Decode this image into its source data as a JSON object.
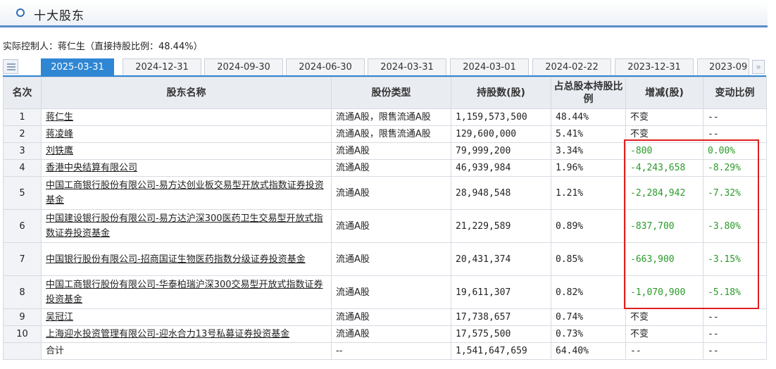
{
  "header": {
    "title": "十大股东"
  },
  "controller_text": "实际控制人：蒋仁生（直接持股比例：48.44%）",
  "tabs": [
    "2025-03-31",
    "2024-12-31",
    "2024-09-30",
    "2024-06-30",
    "2024-03-31",
    "2024-03-01",
    "2024-02-22",
    "2023-12-31",
    "2023-09"
  ],
  "active_tab": "2025-03-31",
  "table": {
    "headers": [
      "名次",
      "股东名称",
      "股份类型",
      "持股数(股)",
      "占总股本持股比例",
      "增减(股)",
      "变动比例"
    ],
    "rows": [
      {
        "rank": "1",
        "name": "蒋仁生",
        "type": "流通A股，限售流通A股",
        "shares": "1,159,573,500",
        "pct": "48.44%",
        "change": "不变",
        "ratio": "--"
      },
      {
        "rank": "2",
        "name": "蒋凌峰",
        "type": "流通A股，限售流通A股",
        "shares": "129,600,000",
        "pct": "5.41%",
        "change": "不变",
        "ratio": "--"
      },
      {
        "rank": "3",
        "name": "刘铁鹰",
        "type": "流通A股",
        "shares": "79,999,200",
        "pct": "3.34%",
        "change": "-800",
        "ratio": "0.00%"
      },
      {
        "rank": "4",
        "name": "香港中央结算有限公司",
        "type": "流通A股",
        "shares": "46,939,984",
        "pct": "1.96%",
        "change": "-4,243,658",
        "ratio": "-8.29%"
      },
      {
        "rank": "5",
        "name": "中国工商银行股份有限公司-易方达创业板交易型开放式指数证券投资基金",
        "type": "流通A股",
        "shares": "28,948,548",
        "pct": "1.21%",
        "change": "-2,284,942",
        "ratio": "-7.32%"
      },
      {
        "rank": "6",
        "name": "中国建设银行股份有限公司-易方达沪深300医药卫生交易型开放式指数证券投资基金",
        "type": "流通A股",
        "shares": "21,229,589",
        "pct": "0.89%",
        "change": "-837,700",
        "ratio": "-3.80%"
      },
      {
        "rank": "7",
        "name": "中国银行股份有限公司-招商国证生物医药指数分级证券投资基金",
        "type": "流通A股",
        "shares": "20,431,374",
        "pct": "0.85%",
        "change": "-663,900",
        "ratio": "-3.15%"
      },
      {
        "rank": "8",
        "name": "中国工商银行股份有限公司-华泰柏瑞沪深300交易型开放式指数证券投资基金",
        "type": "流通A股",
        "shares": "19,611,307",
        "pct": "0.82%",
        "change": "-1,070,900",
        "ratio": "-5.18%"
      },
      {
        "rank": "9",
        "name": "吴冠江",
        "type": "流通A股",
        "shares": "17,738,657",
        "pct": "0.74%",
        "change": "不变",
        "ratio": "--"
      },
      {
        "rank": "10",
        "name": "上海迎水投资管理有限公司-迎水合力13号私募证券投资基金",
        "type": "流通A股",
        "shares": "17,575,500",
        "pct": "0.73%",
        "change": "不变",
        "ratio": "--"
      }
    ],
    "total": {
      "label": "合计",
      "type": "--",
      "shares": "1,541,647,659",
      "pct": "64.40%",
      "change": "--",
      "ratio": "--"
    }
  },
  "colors": {
    "accent": "#2f86d3",
    "decrease": "#2a9a28",
    "highlight": "#e02020"
  }
}
